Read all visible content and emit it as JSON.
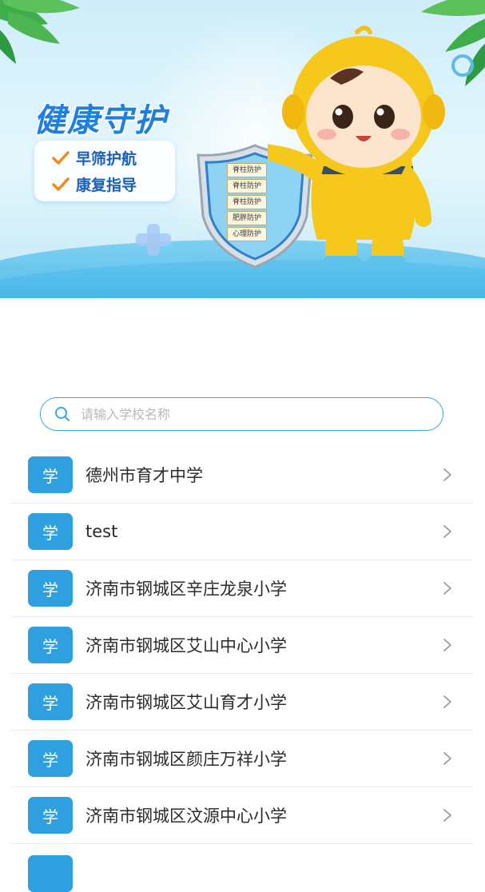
{
  "banner": {
    "title": "健康守护",
    "features": [
      "早筛护航",
      "康复指导"
    ],
    "shield_labels": [
      "脊柱防护",
      "脊柱防护",
      "脊柱防护",
      "肥胖防护",
      "心理防护"
    ]
  },
  "search": {
    "placeholder": "请输入学校名称",
    "value": ""
  },
  "school_list": {
    "avatar_label": "学",
    "items": [
      "德州市育才中学",
      "test",
      "济南市钢城区辛庄龙泉小学",
      "济南市钢城区艾山中心小学",
      "济南市钢城区艾山育才小学",
      "济南市钢城区颜庄万祥小学",
      "济南市钢城区汶源中心小学"
    ]
  },
  "colors": {
    "accent": "#2fa0df",
    "search_border": "#39a7e1",
    "title": "#1f7fe0",
    "feature_text": "#1c5fb8",
    "check": "#f08a1c"
  },
  "icons": [
    "search-icon",
    "chevron-right-icon",
    "check-icon",
    "plus-icon",
    "shield-icon",
    "leaf-icon"
  ]
}
